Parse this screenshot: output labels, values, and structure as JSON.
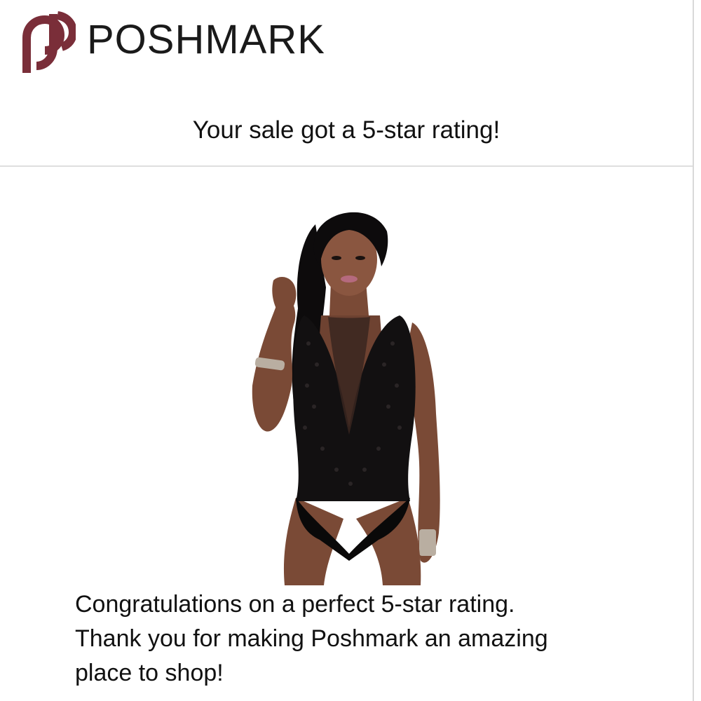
{
  "brand": {
    "name": "POSHMARK",
    "logo_icon": "poshmark-p-logo",
    "color": "#7a2e39"
  },
  "email": {
    "headline": "Your sale got a 5-star rating!",
    "product_image_icon": "product-photo-black-lace-bodysuit",
    "message_lines": [
      "Congratulations on a perfect 5-star rating.",
      "Thank you for making Poshmark an amazing",
      "place to shop!"
    ]
  }
}
